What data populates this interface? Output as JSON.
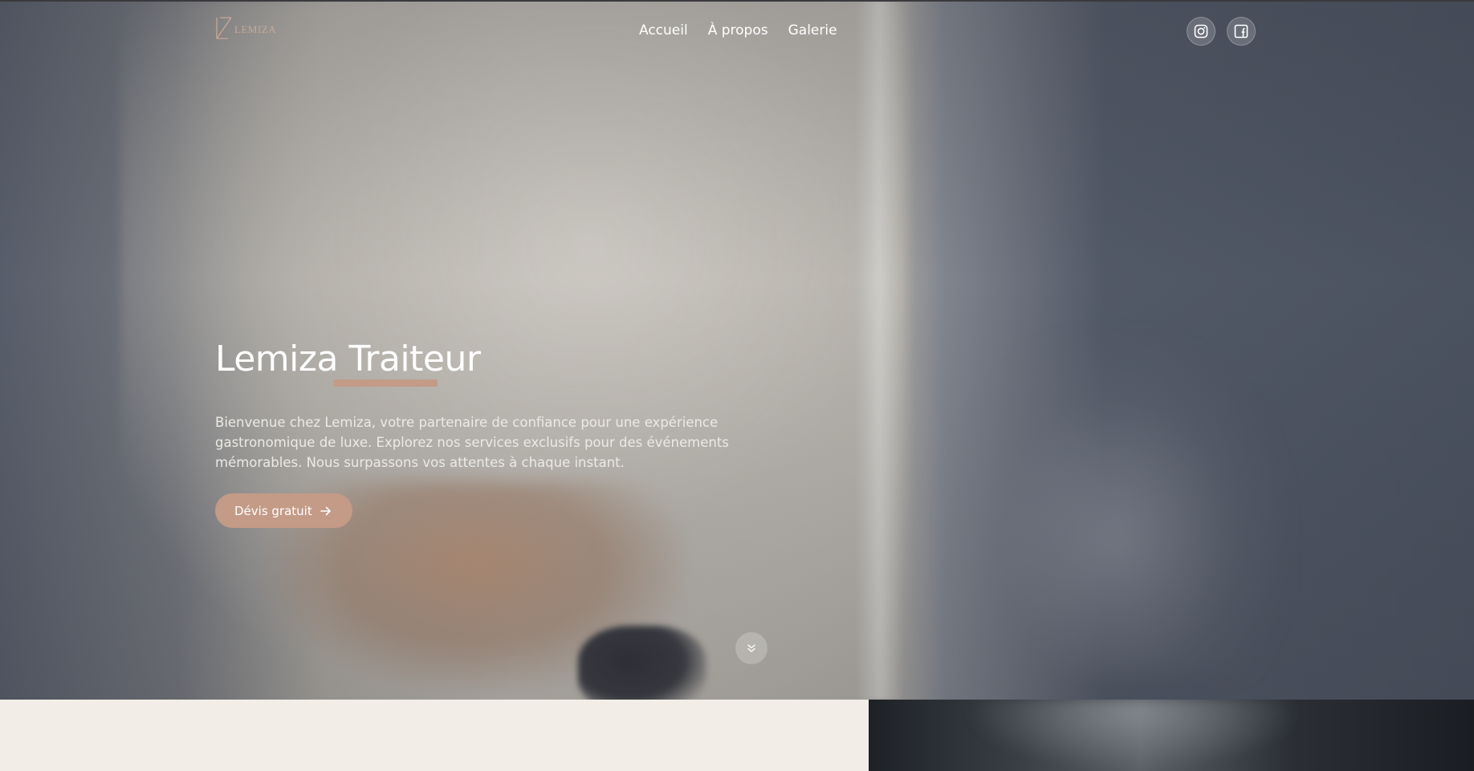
{
  "brand": {
    "name": "LEMIZA"
  },
  "nav": {
    "links": [
      {
        "label": "Accueil"
      },
      {
        "label": "À propos"
      },
      {
        "label": "Galerie"
      }
    ]
  },
  "socials": [
    {
      "icon": "instagram-icon"
    },
    {
      "icon": "facebook-icon"
    }
  ],
  "hero": {
    "title": "Lemiza Traiteur",
    "description": "Bienvenue chez Lemiza, votre partenaire de confiance pour une expérience gastronomique de luxe. Explorez nos services exclusifs pour des événements mémorables. Nous surpassons vos attentes à chaque instant.",
    "cta_label": "Dévis gratuit"
  },
  "colors": {
    "accent": "#c39b87",
    "section_bg": "#f2ede6"
  }
}
